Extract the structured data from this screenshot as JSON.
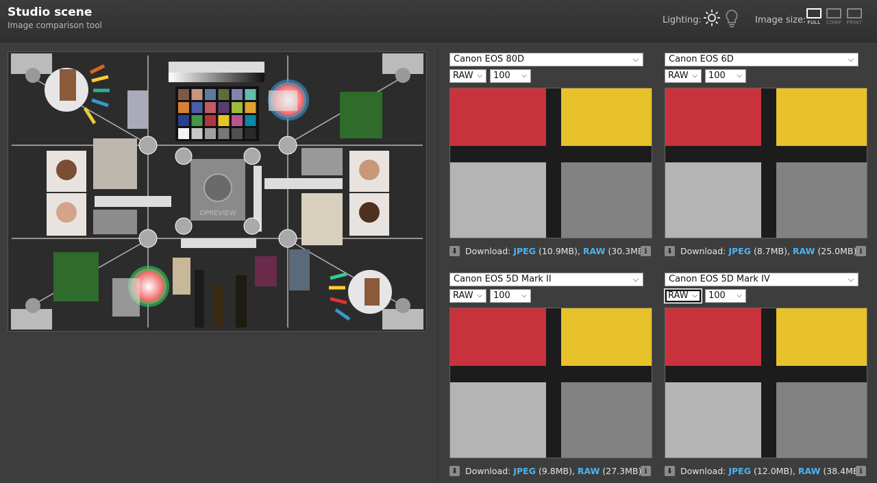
{
  "header": {
    "title": "Studio scene",
    "subtitle": "Image comparison tool",
    "lighting_label": "Lighting:",
    "lighting_options": [
      "daylight-icon",
      "tungsten-bulb-icon"
    ],
    "image_size_label": "Image size:",
    "size_options": [
      {
        "label": "FULL",
        "active": true
      },
      {
        "label": "COMP",
        "active": false
      },
      {
        "label": "PRINT",
        "active": false
      }
    ]
  },
  "panels": [
    {
      "camera": "Canon EOS 80D",
      "format": "RAW",
      "iso": "100",
      "dl_label": "Download:",
      "jpeg": "JPEG",
      "jpeg_size": "(10.9MB),",
      "raw": "RAW",
      "raw_size": "(30.3MB)"
    },
    {
      "camera": "Canon EOS 6D",
      "format": "RAW",
      "iso": "100",
      "dl_label": "Download:",
      "jpeg": "JPEG",
      "jpeg_size": "(8.7MB),",
      "raw": "RAW",
      "raw_size": "(25.0MB)"
    },
    {
      "camera": "Canon EOS 5D Mark II",
      "format": "RAW",
      "iso": "100",
      "dl_label": "Download:",
      "jpeg": "JPEG",
      "jpeg_size": "(9.8MB),",
      "raw": "RAW",
      "raw_size": "(27.3MB)"
    },
    {
      "camera": "Canon EOS 5D Mark IV",
      "format": "RAW",
      "iso": "100",
      "dl_label": "Download:",
      "jpeg": "JPEG",
      "jpeg_size": "(12.0MB),",
      "raw": "RAW",
      "raw_size": "(38.4MB)"
    }
  ],
  "scene_labels": {
    "watermark": "DPREVIEW"
  },
  "colors": {
    "link": "#4db3ef",
    "crop_red": "#c8323c",
    "crop_yellow": "#e8c22a",
    "crop_light_gray": "#b4b4b4",
    "crop_mid_gray": "#828282"
  }
}
